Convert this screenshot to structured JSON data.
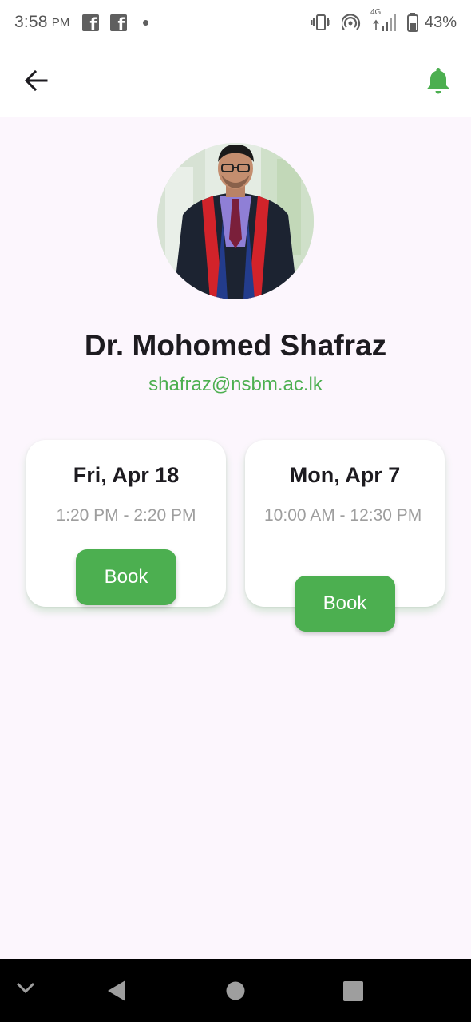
{
  "status_bar": {
    "time": "3:58",
    "ampm": "PM",
    "network": "4G",
    "battery": "43%"
  },
  "app_bar": {
    "back_icon": "arrow-left-icon",
    "bell_icon": "bell-icon"
  },
  "profile": {
    "name": "Dr. Mohomed Shafraz",
    "email": "shafraz@nsbm.ac.lk"
  },
  "slots": [
    {
      "date": "Fri, Apr 18",
      "time": "1:20 PM - 2:20 PM",
      "button_label": "Book"
    },
    {
      "date": "Mon, Apr 7",
      "time": "10:00 AM - 12:30 PM",
      "button_label": "Book"
    }
  ],
  "colors": {
    "accent": "#4caf50",
    "background": "#fcf6fd",
    "text_primary": "#1d1b20",
    "text_secondary": "#9e9e9e"
  }
}
